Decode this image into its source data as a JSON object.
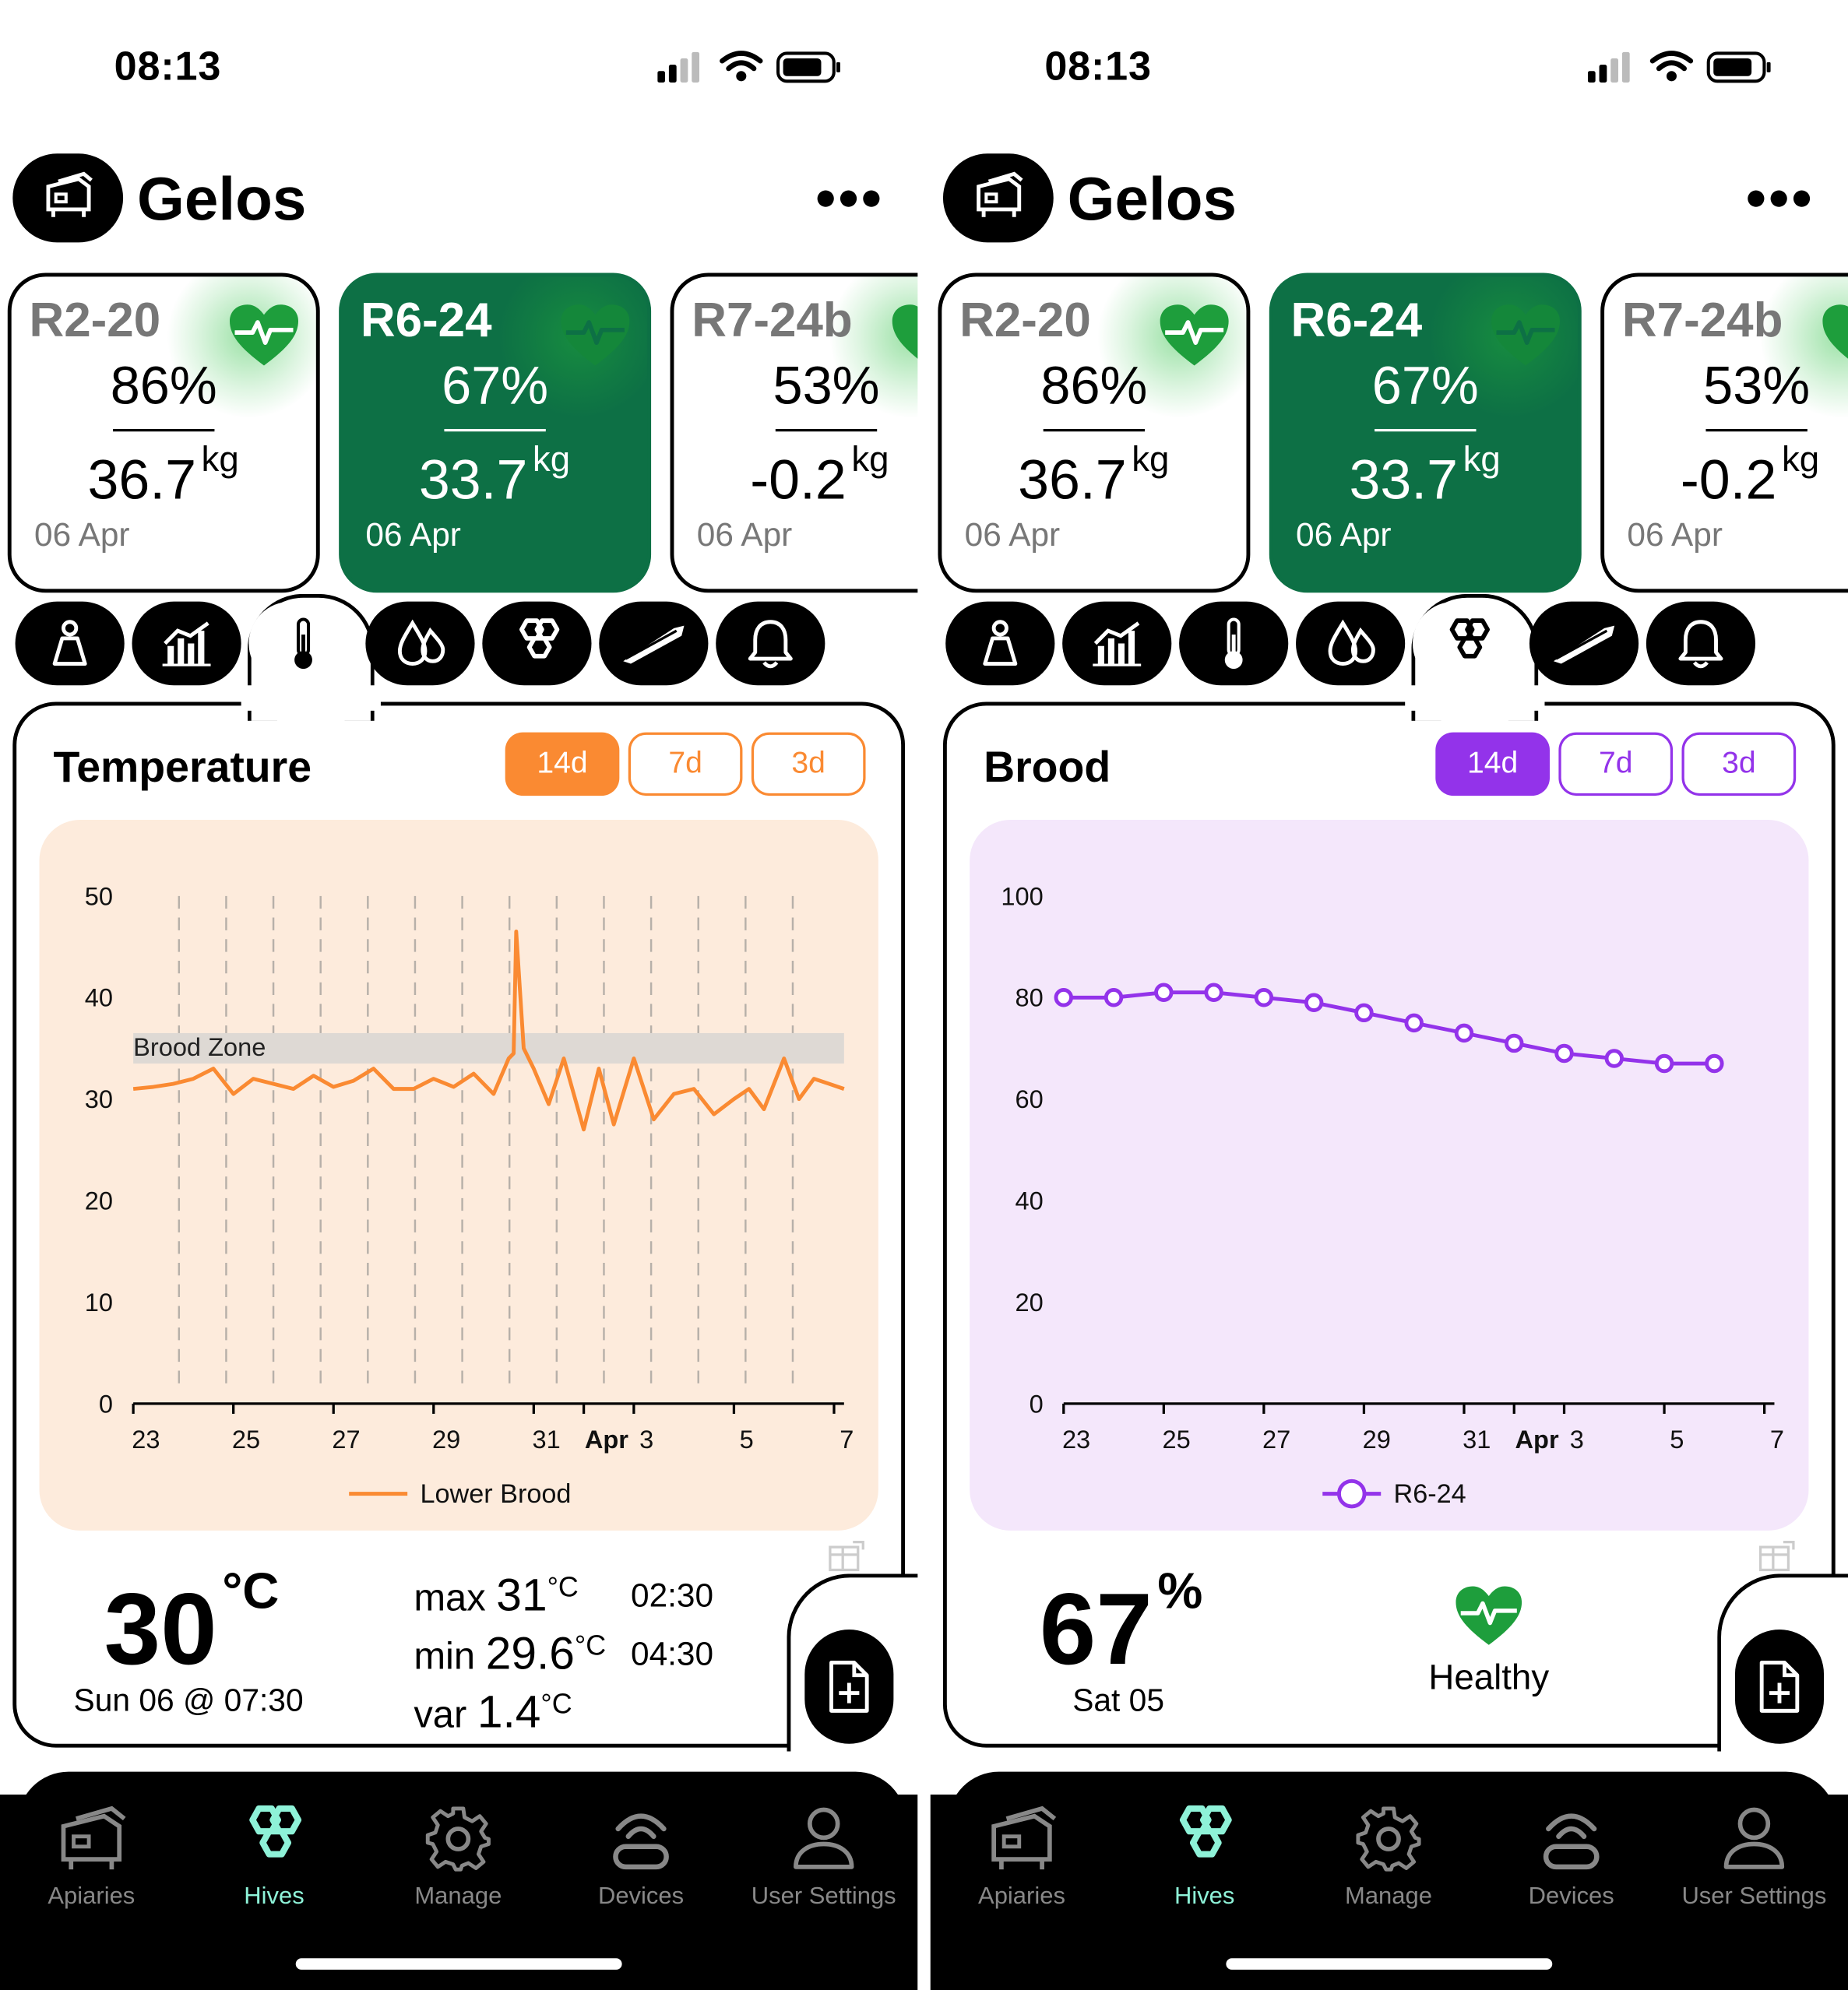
{
  "status_bar": {
    "time": "08:13"
  },
  "apiary": {
    "name": "Gelos"
  },
  "hive_cards": [
    {
      "name": "R2-20",
      "percent": "86%",
      "weight": "36.7",
      "unit": "kg",
      "date": "06 Apr",
      "selected": false
    },
    {
      "name": "R6-24",
      "percent": "67%",
      "weight": "33.7",
      "unit": "kg",
      "date": "06 Apr",
      "selected": true
    },
    {
      "name": "R7-24b",
      "percent": "53%",
      "weight": "-0.2",
      "unit": "kg",
      "date": "06 Apr",
      "selected": false
    }
  ],
  "metric_tabs": [
    "person-scale-icon",
    "weight-chart-icon",
    "thermometer-icon",
    "humidity-drops-icon",
    "honeycomb-icon",
    "hive-tool-icon",
    "bell-icon"
  ],
  "ranges": [
    "14d",
    "7d",
    "3d"
  ],
  "temperature": {
    "title": "Temperature",
    "accent": "#fa8a32",
    "big_value": "30",
    "big_unit": "°C",
    "big_date": "Sun 06 @ 07:30",
    "max_label": "max",
    "max_value": "31",
    "max_unit": "°C",
    "max_time": "02:30",
    "min_label": "min",
    "min_value": "29.6",
    "min_unit": "°C",
    "min_time": "04:30",
    "var_label": "var",
    "var_value": "1.4",
    "var_unit": "°C"
  },
  "brood": {
    "title": "Brood",
    "accent": "#9333ea",
    "big_value": "67",
    "big_unit": "%",
    "big_date": "Sat 05",
    "status": "Healthy"
  },
  "chart_data": [
    {
      "type": "line",
      "xlabel": "",
      "ylabel": "",
      "ylim": [
        0,
        50
      ],
      "yticks": [
        "0",
        "10",
        "20",
        "30",
        "40",
        "50"
      ],
      "xticks": [
        "23",
        "25",
        "27",
        "29",
        "31",
        "Apr",
        "3",
        "5",
        "7"
      ],
      "band": {
        "label": "Brood Zone",
        "from": 33.5,
        "to": 36.5
      },
      "series": [
        {
          "name": "Lower Brood",
          "color": "#fa8a32",
          "x": [
            23,
            23.4,
            23.8,
            24.2,
            24.6,
            25,
            25.4,
            25.8,
            26.2,
            26.6,
            27,
            27.4,
            27.8,
            28.2,
            28.6,
            29,
            29.4,
            29.8,
            30.2,
            30.5,
            30.6,
            30.65,
            30.8,
            31,
            31.3,
            31.6,
            32,
            32.3,
            32.6,
            33,
            33.4,
            33.8,
            34.2,
            34.6,
            35,
            35.3,
            35.6,
            36,
            36.3,
            36.6,
            36.9,
            37.2
          ],
          "values": [
            31,
            31.2,
            31.5,
            32,
            33,
            30.5,
            32,
            31.5,
            31,
            32.3,
            31.2,
            31.8,
            33,
            31,
            31,
            32,
            31.2,
            32.5,
            30.5,
            34,
            34.5,
            46.5,
            35,
            33,
            29.5,
            34,
            27,
            33,
            27.5,
            34,
            28,
            30.5,
            31,
            28.5,
            30,
            31,
            29,
            34,
            30,
            32,
            31.5,
            31
          ]
        }
      ]
    },
    {
      "type": "line",
      "xlabel": "",
      "ylabel": "",
      "ylim": [
        0,
        100
      ],
      "yticks": [
        "0",
        "20",
        "40",
        "60",
        "80",
        "100"
      ],
      "xticks": [
        "23",
        "25",
        "27",
        "29",
        "31",
        "Apr",
        "3",
        "5",
        "7"
      ],
      "series": [
        {
          "name": "R6-24",
          "color": "#9333ea",
          "x": [
            23,
            24,
            25,
            26,
            27,
            28,
            29,
            30,
            31,
            32,
            33,
            34,
            35,
            36
          ],
          "values": [
            80,
            80,
            81,
            81,
            80,
            79,
            77,
            75,
            73,
            71,
            69,
            68,
            67,
            67
          ]
        }
      ]
    }
  ],
  "nav": [
    {
      "label": "Apiaries",
      "icon": "apiaries-icon"
    },
    {
      "label": "Hives",
      "icon": "hives-icon",
      "active": true
    },
    {
      "label": "Manage",
      "icon": "gear-icon"
    },
    {
      "label": "Devices",
      "icon": "devices-icon"
    },
    {
      "label": "User Settings",
      "icon": "user-icon"
    }
  ]
}
